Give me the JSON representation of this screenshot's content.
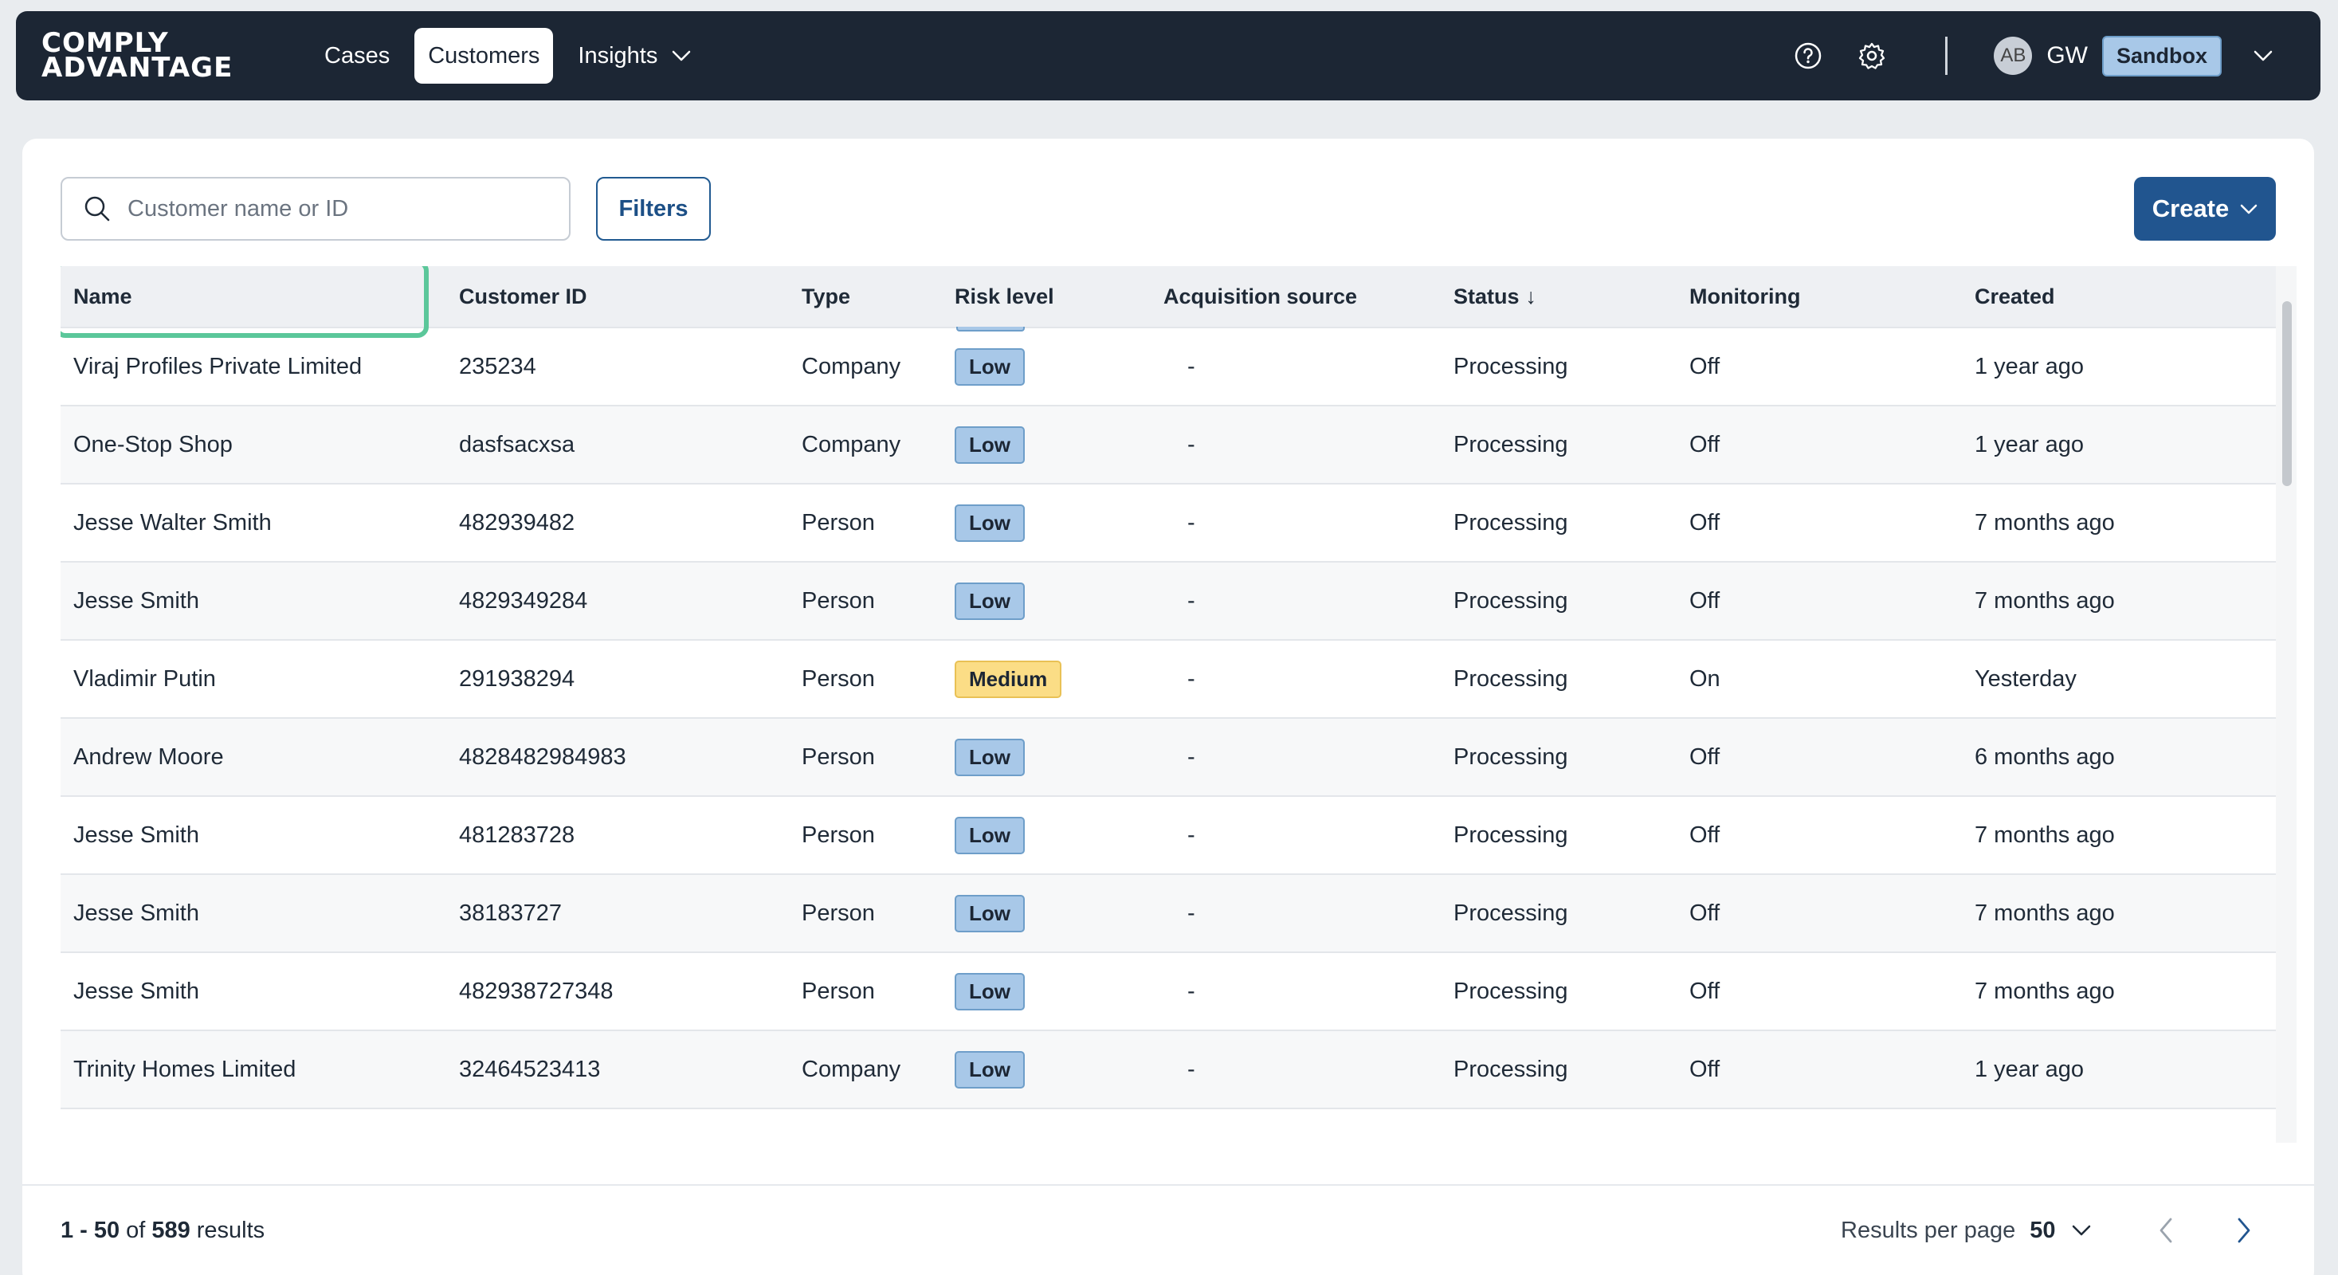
{
  "nav": {
    "logo_line1": "COMPLY",
    "logo_line2": "ADVANTAGE",
    "items": [
      {
        "label": "Cases"
      },
      {
        "label": "Customers"
      },
      {
        "label": "Insights"
      }
    ],
    "avatar_initials": "AB",
    "user_initials": "GW",
    "environment": "Sandbox",
    "icons": [
      "help-icon",
      "settings-icon",
      "chevron-down-icon"
    ]
  },
  "toolbar": {
    "search_placeholder": "Customer name or ID",
    "filters_label": "Filters",
    "create_label": "Create"
  },
  "table": {
    "columns": [
      "Name",
      "Customer ID",
      "Type",
      "Risk level",
      "Acquisition source",
      "Status",
      "Monitoring",
      "Created"
    ],
    "sort_indicator": "↓",
    "rows": [
      {
        "name": "Viraj Profiles Private Limited",
        "id": "235234",
        "type": "Company",
        "risk": "Low",
        "source": "-",
        "status": "Processing",
        "monitoring": "Off",
        "created": "1 year ago"
      },
      {
        "name": "One-Stop Shop",
        "id": "dasfsacxsa",
        "type": "Company",
        "risk": "Low",
        "source": "-",
        "status": "Processing",
        "monitoring": "Off",
        "created": "1 year ago"
      },
      {
        "name": "Jesse Walter Smith",
        "id": "482939482",
        "type": "Person",
        "risk": "Low",
        "source": "-",
        "status": "Processing",
        "monitoring": "Off",
        "created": "7 months ago"
      },
      {
        "name": "Jesse Smith",
        "id": "4829349284",
        "type": "Person",
        "risk": "Low",
        "source": "-",
        "status": "Processing",
        "monitoring": "Off",
        "created": "7 months ago"
      },
      {
        "name": "Vladimir Putin",
        "id": "291938294",
        "type": "Person",
        "risk": "Medium",
        "source": "-",
        "status": "Processing",
        "monitoring": "On",
        "created": "Yesterday"
      },
      {
        "name": "Andrew Moore",
        "id": "4828482984983",
        "type": "Person",
        "risk": "Low",
        "source": "-",
        "status": "Processing",
        "monitoring": "Off",
        "created": "6 months ago"
      },
      {
        "name": "Jesse Smith",
        "id": "481283728",
        "type": "Person",
        "risk": "Low",
        "source": "-",
        "status": "Processing",
        "monitoring": "Off",
        "created": "7 months ago"
      },
      {
        "name": "Jesse Smith",
        "id": "38183727",
        "type": "Person",
        "risk": "Low",
        "source": "-",
        "status": "Processing",
        "monitoring": "Off",
        "created": "7 months ago"
      },
      {
        "name": "Jesse Smith",
        "id": "482938727348",
        "type": "Person",
        "risk": "Low",
        "source": "-",
        "status": "Processing",
        "monitoring": "Off",
        "created": "7 months ago"
      },
      {
        "name": "Trinity Homes Limited",
        "id": "32464523413",
        "type": "Company",
        "risk": "Low",
        "source": "-",
        "status": "Processing",
        "monitoring": "Off",
        "created": "1 year ago"
      }
    ]
  },
  "footer": {
    "range": "1 - 50",
    "of": "of",
    "total": "589",
    "results": "results",
    "per_page_label": "Results per page",
    "per_page_value": "50"
  },
  "colors": {
    "nav_bg": "#1c2634",
    "primary": "#21558f",
    "risk_low": "#a8c8e8",
    "risk_medium": "#fbdd86",
    "focus_ring": "#5bc79a"
  }
}
